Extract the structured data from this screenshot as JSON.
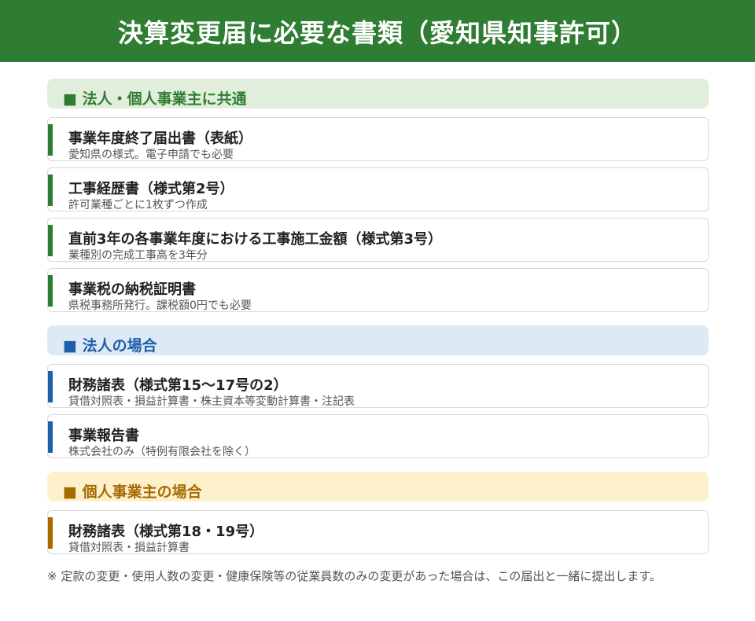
{
  "header": {
    "title": "決算変更届に必要な書類（愛知県知事許可）"
  },
  "colors": {
    "header_bg": "#2e7d32",
    "common": "#2e7d32",
    "corporate": "#1f5fa8",
    "individual": "#a56a00"
  },
  "sections": [
    {
      "heading": "■ 法人・個人事業主に共通",
      "items": [
        {
          "title": "事業年度終了届出書（表紙）",
          "sub": "愛知県の様式。電子申請でも必要"
        },
        {
          "title": "工事経歴書（様式第2号）",
          "sub": "許可業種ごとに1枚ずつ作成"
        },
        {
          "title": "直前3年の各事業年度における工事施工金額（様式第3号）",
          "sub": "業種別の完成工事高を3年分"
        },
        {
          "title": "事業税の納税証明書",
          "sub": "県税事務所発行。課税額0円でも必要"
        }
      ]
    },
    {
      "heading": "■ 法人の場合",
      "items": [
        {
          "title": "財務諸表（様式第15〜17号の2）",
          "sub": "貸借対照表・損益計算書・株主資本等変動計算書・注記表"
        },
        {
          "title": "事業報告書",
          "sub": "株式会社のみ（特例有限会社を除く）"
        }
      ]
    },
    {
      "heading": "■ 個人事業主の場合",
      "items": [
        {
          "title": "財務諸表（様式第18・19号）",
          "sub": "貸借対照表・損益計算書"
        }
      ]
    }
  ],
  "footnote": "※ 定款の変更・使用人数の変更・健康保険等の従業員数のみの変更があった場合は、この届出と一緒に提出します。"
}
